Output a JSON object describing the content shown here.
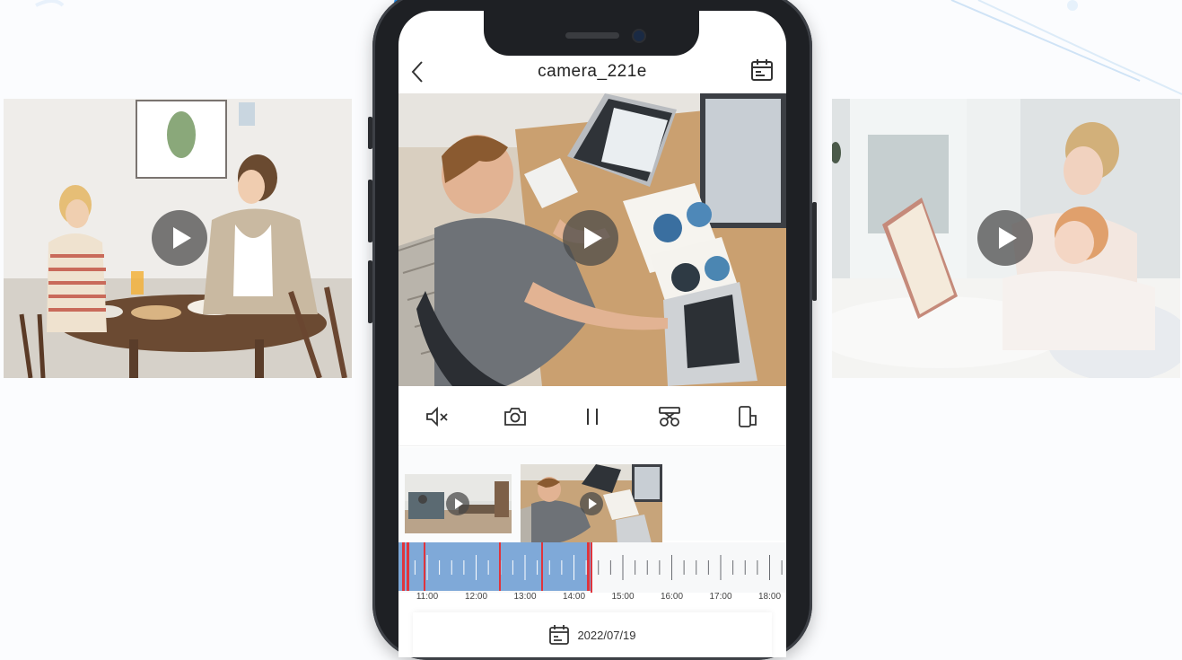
{
  "camera": {
    "title": "camera_221e",
    "date": "2022/07/19"
  },
  "icons": {
    "back": "chevron-left-icon",
    "calendar": "calendar-icon",
    "side_left_play": "play-icon",
    "main_play": "play-icon",
    "side_right_play": "play-icon"
  },
  "toolbar": [
    {
      "name": "mute-toggle-button",
      "icon": "speaker-mute-icon"
    },
    {
      "name": "snapshot-button",
      "icon": "camera-icon"
    },
    {
      "name": "pause-button",
      "icon": "pause-icon"
    },
    {
      "name": "clip-button",
      "icon": "scissors-icon"
    },
    {
      "name": "orientation-button",
      "icon": "rotate-screen-icon"
    }
  ],
  "timeline": {
    "labels": [
      "11:00",
      "12:00",
      "13:00",
      "14:00",
      "15:00",
      "16:00",
      "17:00",
      "18:00"
    ],
    "recorded_until": "14:20"
  },
  "colors": {
    "recorded": "#7fa9d8",
    "event_marker": "#e0343c",
    "accent_light": "#d8ecfb"
  }
}
